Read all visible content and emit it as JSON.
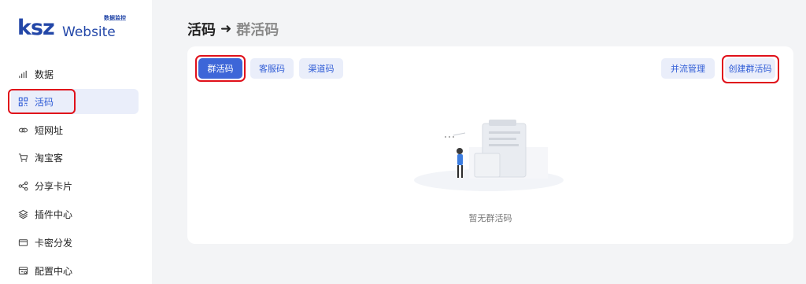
{
  "logo": {
    "ksz": "ksz",
    "website": "Website",
    "subtitle": "数据监控"
  },
  "sidebar": {
    "items": [
      {
        "label": "数据",
        "icon": "bar-chart-icon"
      },
      {
        "label": "活码",
        "icon": "qr-code-icon",
        "active": true
      },
      {
        "label": "短网址",
        "icon": "link-icon"
      },
      {
        "label": "淘宝客",
        "icon": "cart-icon"
      },
      {
        "label": "分享卡片",
        "icon": "share-icon"
      },
      {
        "label": "插件中心",
        "icon": "layers-icon"
      },
      {
        "label": "卡密分发",
        "icon": "card-icon"
      },
      {
        "label": "配置中心",
        "icon": "settings-panel-icon"
      }
    ]
  },
  "header": {
    "title": "活码",
    "arrow": "➜",
    "subtitle": "群活码"
  },
  "tabs": {
    "group": "群活码",
    "service": "客服码",
    "channel": "渠道码"
  },
  "actions": {
    "merge": "并流管理",
    "create": "创建群活码"
  },
  "empty": {
    "text": "暂无群活码"
  },
  "colors": {
    "accent": "#3d66d8",
    "highlight": "#e0101a",
    "active_bg": "#eaeefa"
  }
}
